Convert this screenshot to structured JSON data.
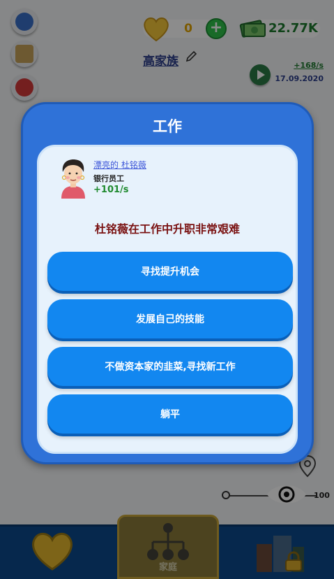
{
  "header": {
    "hearts_value": "0",
    "money_value": "22.77K",
    "family_name": "高家族",
    "income_rate": "+168/s",
    "date": "17.09.2020"
  },
  "slider": {
    "max_label": "100"
  },
  "bottom_nav": {
    "family_label": "家庭"
  },
  "dialog": {
    "title": "工作",
    "person": {
      "name": "漂亮的 杜铭薇",
      "job": "银行员工",
      "income": "+101/s"
    },
    "question": "杜铭薇在工作中升职非常艰难",
    "options": [
      {
        "label": "寻找提升机会"
      },
      {
        "label": "发展自己的技能"
      },
      {
        "label": "不做资本家的韭菜,寻找新工作"
      },
      {
        "label": "躺平"
      }
    ]
  },
  "colors": {
    "dialog_bg": "#2f72d8",
    "card_bg": "#e7f2fc",
    "button": "#1287f0",
    "question_text": "#7a1212"
  }
}
